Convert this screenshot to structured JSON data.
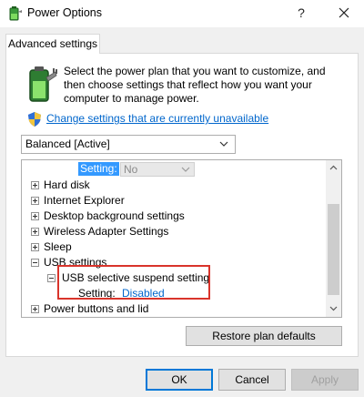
{
  "window": {
    "title": "Power Options",
    "help_glyph": "?"
  },
  "tab": {
    "label": "Advanced settings"
  },
  "intro": {
    "text": "Select the power plan that you want to customize, and then choose settings that reflect how you want your computer to manage power.",
    "change_link": "Change settings that are currently unavailable"
  },
  "plan": {
    "selected": "Balanced [Active]"
  },
  "tree": {
    "top_setting_label": "Setting:",
    "top_setting_value": "No",
    "items": [
      {
        "label": "Hard disk"
      },
      {
        "label": "Internet Explorer"
      },
      {
        "label": "Desktop background settings"
      },
      {
        "label": "Wireless Adapter Settings"
      },
      {
        "label": "Sleep"
      },
      {
        "label": "USB settings"
      },
      {
        "label": "USB selective suspend setting"
      },
      {
        "label": "Power buttons and lid"
      }
    ],
    "usb_setting_label": "Setting:",
    "usb_setting_value": "Disabled"
  },
  "buttons": {
    "restore": "Restore plan defaults",
    "ok": "OK",
    "cancel": "Cancel",
    "apply": "Apply"
  },
  "colors": {
    "link": "#0066cc",
    "selection": "#3399ff",
    "highlight_box": "#d9342b",
    "dialog_bg": "#f0f0f0"
  },
  "icons": {
    "app": "power-options-icon",
    "battery": "battery-plug-icon",
    "shield": "uac-shield-icon"
  }
}
